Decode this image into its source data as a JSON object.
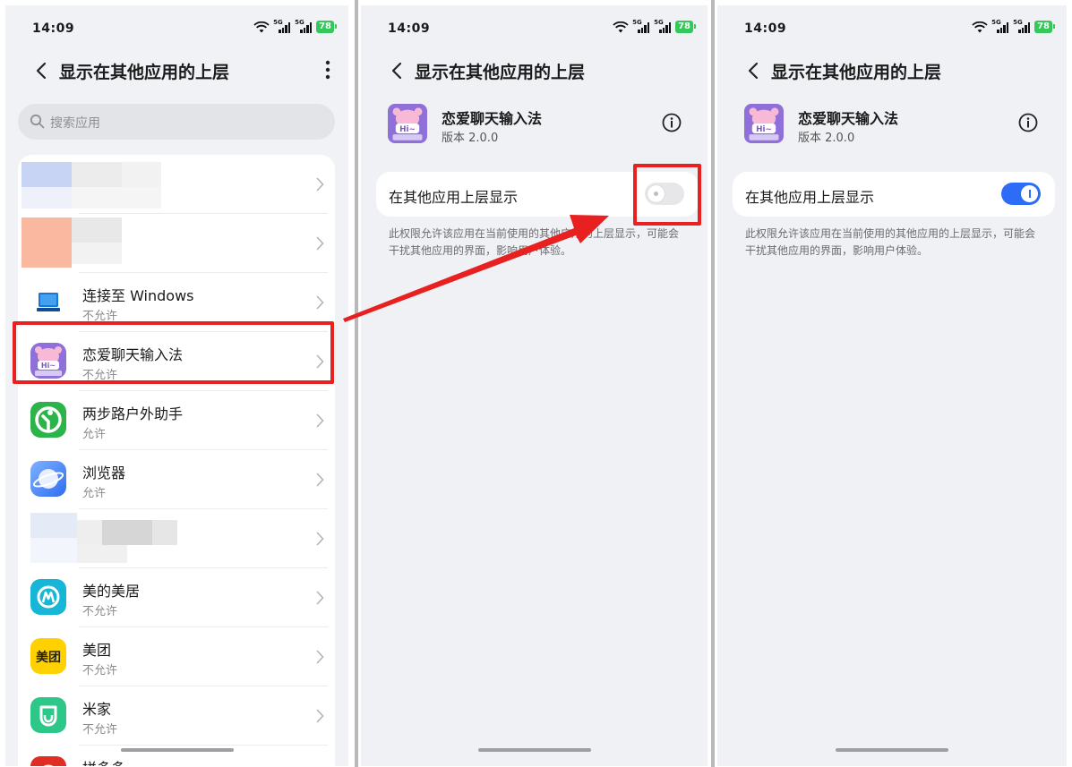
{
  "status_bar": {
    "time": "14:09",
    "network_1": "5G",
    "network_2": "5G",
    "battery": "78"
  },
  "list_screen": {
    "title": "显示在其他应用的上层",
    "search_placeholder": "搜索应用",
    "apps": [
      {
        "name": "",
        "status": "",
        "blurred": true
      },
      {
        "name": "",
        "status": "",
        "blurred": true
      },
      {
        "name": "连接至 Windows",
        "status": "不允许",
        "icon": "link-to-windows-icon"
      },
      {
        "name": "恋爱聊天输入法",
        "status": "不允许",
        "icon": "love-chat-keyboard-icon"
      },
      {
        "name": "两步路户外助手",
        "status": "允许",
        "icon": "two-step-outdoor-icon"
      },
      {
        "name": "浏览器",
        "status": "允许",
        "icon": "browser-icon"
      },
      {
        "name": "",
        "status": "",
        "blurred": true
      },
      {
        "name": "美的美居",
        "status": "不允许",
        "icon": "midea-icon"
      },
      {
        "name": "美团",
        "status": "不允许",
        "icon": "meituan-icon",
        "icon_text": "美团"
      },
      {
        "name": "米家",
        "status": "不允许",
        "icon": "mijia-icon"
      },
      {
        "name": "拼多多",
        "status": "",
        "icon": "pinduoduo-icon"
      }
    ]
  },
  "detail_screen_off": {
    "title": "显示在其他应用的上层",
    "app_name": "恋爱聊天输入法",
    "version": "版本 2.0.0",
    "setting_label": "在其他应用上层显示",
    "toggle_on": false,
    "description": "此权限允许该应用在当前使用的其他应用的上层显示，可能会干扰其他应用的界面，影响用户体验。"
  },
  "detail_screen_on": {
    "title": "显示在其他应用的上层",
    "app_name": "恋爱聊天输入法",
    "version": "版本 2.0.0",
    "setting_label": "在其他应用上层显示",
    "toggle_on": true,
    "description": "此权限允许该应用在当前使用的其他应用的上层显示，可能会干扰其他应用的界面，影响用户体验。"
  },
  "icon_text": {
    "keyboard": "Hi~"
  },
  "colors": {
    "highlight": "#e8201f",
    "toggle_on": "#2d6cf6",
    "battery": "#34c759"
  }
}
